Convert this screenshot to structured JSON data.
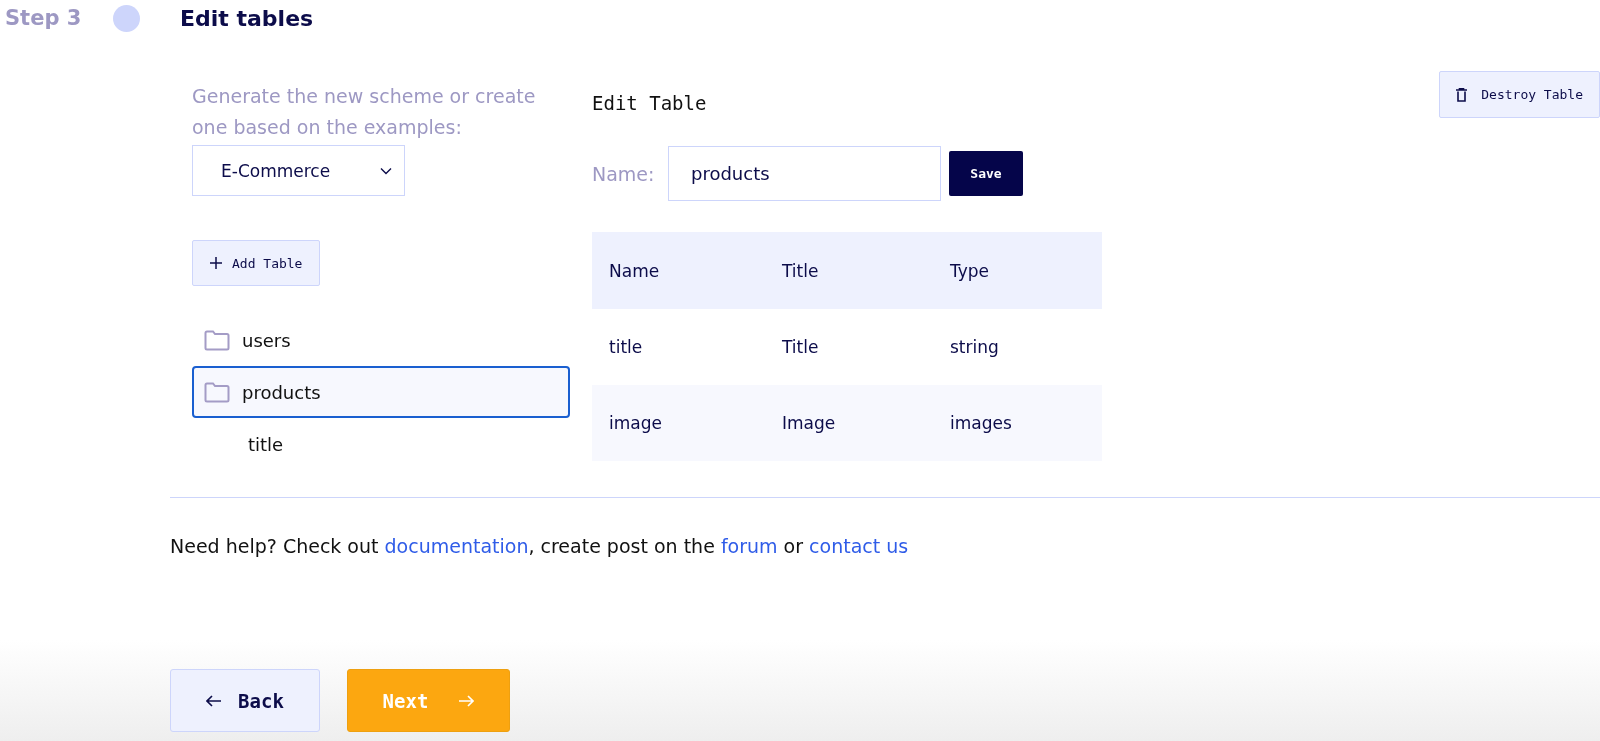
{
  "step": {
    "label": "Step 3",
    "title": "Edit tables"
  },
  "generator": {
    "prompt": "Generate the new scheme or create one based on the examples:",
    "dropdown": {
      "value": "E-Commerce"
    }
  },
  "add_table_button": "Add Table",
  "tree": [
    {
      "label": "users",
      "kind": "folder",
      "selected": false
    },
    {
      "label": "products",
      "kind": "folder",
      "selected": true,
      "children": [
        {
          "label": "title",
          "selected": false
        }
      ]
    }
  ],
  "editor": {
    "title": "Edit Table",
    "destroy_button": "Destroy Table",
    "name_label": "Name:",
    "name_value": "products",
    "save_button": "Save"
  },
  "table": {
    "columns": [
      "Name",
      "Title",
      "Type"
    ],
    "rows": [
      [
        "title",
        "Title",
        "string"
      ],
      [
        "image",
        "Image",
        "images"
      ]
    ]
  },
  "help": {
    "prefix": "Need help? Check out ",
    "link1": "documentation",
    "middle": ", create post on the ",
    "link2": "forum",
    "or": " or ",
    "link3": "contact us"
  },
  "footer": {
    "back": "Back",
    "next": "Next"
  }
}
